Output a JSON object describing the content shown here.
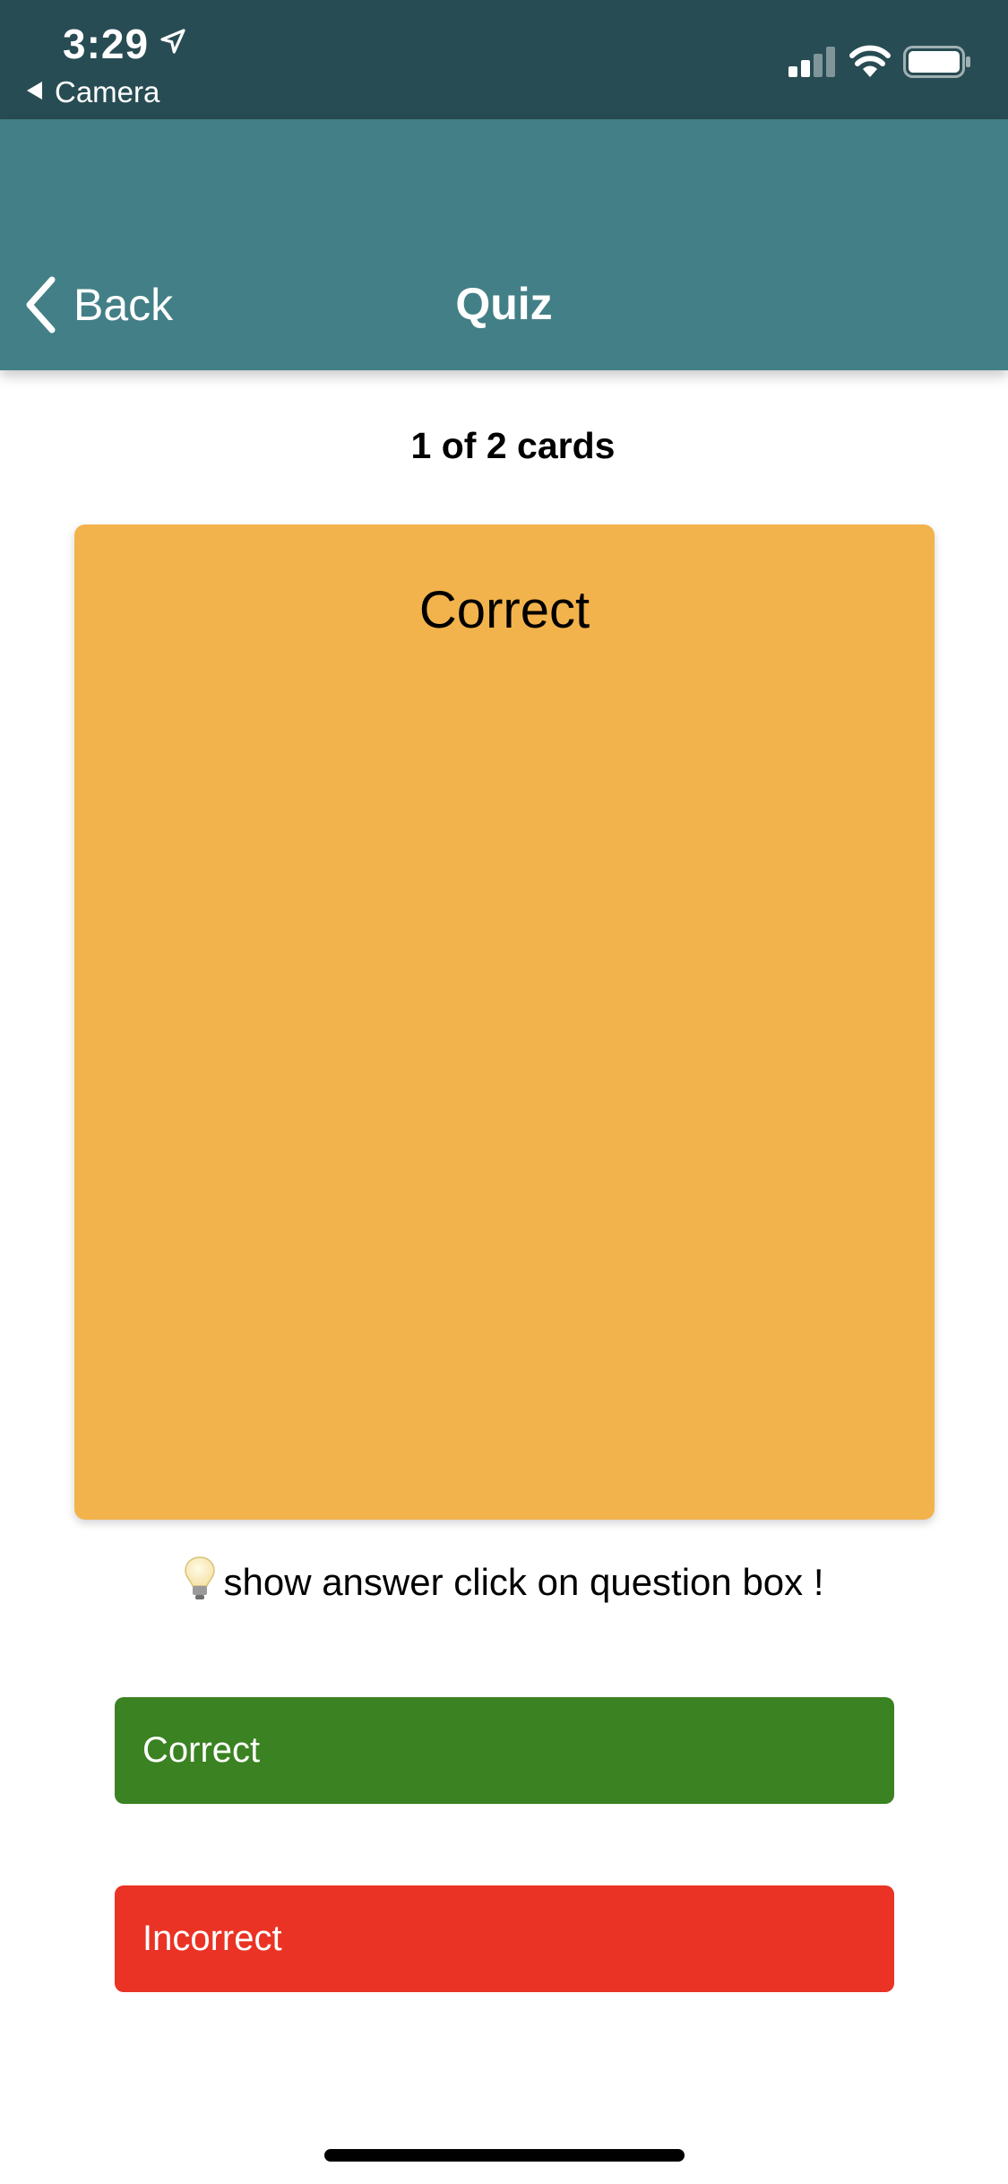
{
  "status_bar": {
    "time": "3:29",
    "back_app_label": "Camera",
    "icons": [
      "location-arrow-icon",
      "cellular-signal-icon",
      "wifi-icon",
      "battery-icon"
    ]
  },
  "nav": {
    "back_label": "Back",
    "title": "Quiz"
  },
  "quiz": {
    "counter": "1 of 2 cards",
    "card_text": "Correct",
    "hint_text": "show answer click on question box !",
    "hint_icon": "lightbulb-icon"
  },
  "buttons": {
    "correct_label": "Correct",
    "incorrect_label": "Incorrect"
  },
  "colors": {
    "status_bar": "#284c53",
    "nav_bar": "#437f86",
    "card": "#f3b34c",
    "correct": "#3b8222",
    "incorrect": "#ea3324"
  }
}
